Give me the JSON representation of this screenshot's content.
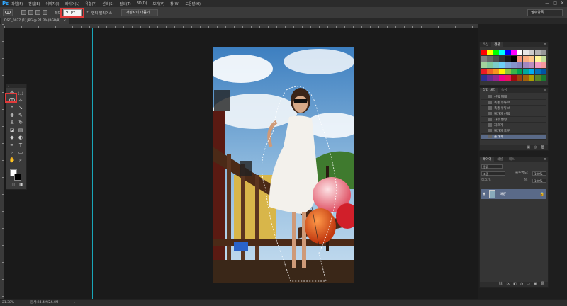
{
  "app": {
    "logo": "Ps"
  },
  "menu": [
    "파일(F)",
    "편집(E)",
    "이미지(I)",
    "레이어(L)",
    "유형(Y)",
    "선택(S)",
    "필터(T)",
    "3D(D)",
    "보기(V)",
    "창(W)",
    "도움말(H)"
  ],
  "window_controls": [
    "—",
    "□",
    "✕"
  ],
  "options": {
    "tool_icon": "lasso-icon",
    "feather_label": "페더:",
    "feather_value": "30 px",
    "antialias_checked": "✓",
    "antialias_label": "앤티 앨리어스",
    "refine_label": "가장자리 다듬기...",
    "workspace": "필수항목"
  },
  "document": {
    "tab_title": "DSC_0027 (1).JPG @ 21.2%(RGB/8)",
    "tab_close": "×"
  },
  "toolbox": {
    "head": "»",
    "tools": [
      "move-icon",
      "marquee-icon",
      "lasso-icon",
      "magic-wand-icon",
      "crop-icon",
      "eyedropper-icon",
      "healing-icon",
      "brush-icon",
      "stamp-icon",
      "history-brush-icon",
      "eraser-icon",
      "gradient-icon",
      "blur-icon",
      "dodge-icon",
      "pen-icon",
      "type-icon",
      "path-select-icon",
      "shape-icon",
      "hand-icon",
      "zoom-icon"
    ],
    "glyphs": [
      "✥",
      "⬚",
      "ↀ",
      "✧",
      "⌗",
      "↘",
      "✚",
      "✎",
      "♙",
      "↻",
      "◪",
      "▤",
      "◆",
      "◐",
      "✒",
      "T",
      "▹",
      "▭",
      "✋",
      "⌕"
    ],
    "colors": {
      "foreground": "#ffffff",
      "background": "#000000"
    },
    "bottom_glyphs": [
      "◫",
      "▣"
    ]
  },
  "panels": {
    "swatches": {
      "tabs": [
        "색상",
        "견본"
      ],
      "menu": "≡",
      "colors": [
        "#ff0000",
        "#ffff00",
        "#00ff00",
        "#00ffff",
        "#0000ff",
        "#ff00ff",
        "#ffffff",
        "#e6e6e6",
        "#cccccc",
        "#b3b3b3",
        "#999999",
        "#808080",
        "#666666",
        "#4d4d4d",
        "#333333",
        "#1a1a1a",
        "#000000",
        "#f7977a",
        "#f9ad81",
        "#fdc68a",
        "#fff79a",
        "#c4df9b",
        "#a2d39c",
        "#82ca9d",
        "#7bcdc8",
        "#6ecff6",
        "#7ea7d8",
        "#8493ca",
        "#8882be",
        "#a187be",
        "#bc8dbf",
        "#f49ac2",
        "#f6989d",
        "#ed1c24",
        "#f26522",
        "#f7941d",
        "#fff200",
        "#8dc63f",
        "#39b54a",
        "#00a651",
        "#00a99d",
        "#00aeef",
        "#0072bc",
        "#0054a6",
        "#2e3192",
        "#662d91",
        "#92278f",
        "#ec008c",
        "#ed145b",
        "#9e0b0f",
        "#a0410d",
        "#a36209",
        "#aba000",
        "#598527",
        "#1a7b30"
      ]
    },
    "history": {
      "tabs": [
        "작업 내역",
        "속성"
      ],
      "menu": "≡",
      "items": [
        "선택 해제",
        "폭풍 유튜브",
        "폭풍 유튜브",
        "올가미 선택",
        "자유 변형",
        "자르기",
        "올가미 도구",
        "올가미"
      ],
      "active_index": 7,
      "footer": [
        "▣",
        "◎",
        "🗑"
      ]
    },
    "layers": {
      "tabs": [
        "레이어",
        "채널",
        "패스"
      ],
      "menu": "≡",
      "kind_label": "종류",
      "blend_mode": "표준",
      "opacity_label": "불투명도:",
      "opacity_value": "100%",
      "lock_label": "잠그기:",
      "fill_label": "칠:",
      "fill_value": "100%",
      "layer_name": "배경",
      "eye": "◉",
      "lock": "🔒",
      "footer": [
        "⛓",
        "fx",
        "◧",
        "◑",
        "▭",
        "▣",
        "🗑"
      ]
    }
  },
  "status": {
    "zoom": "21.38%",
    "doc_info": "문서:24.4M/24.4M",
    "arrow": "▸"
  }
}
